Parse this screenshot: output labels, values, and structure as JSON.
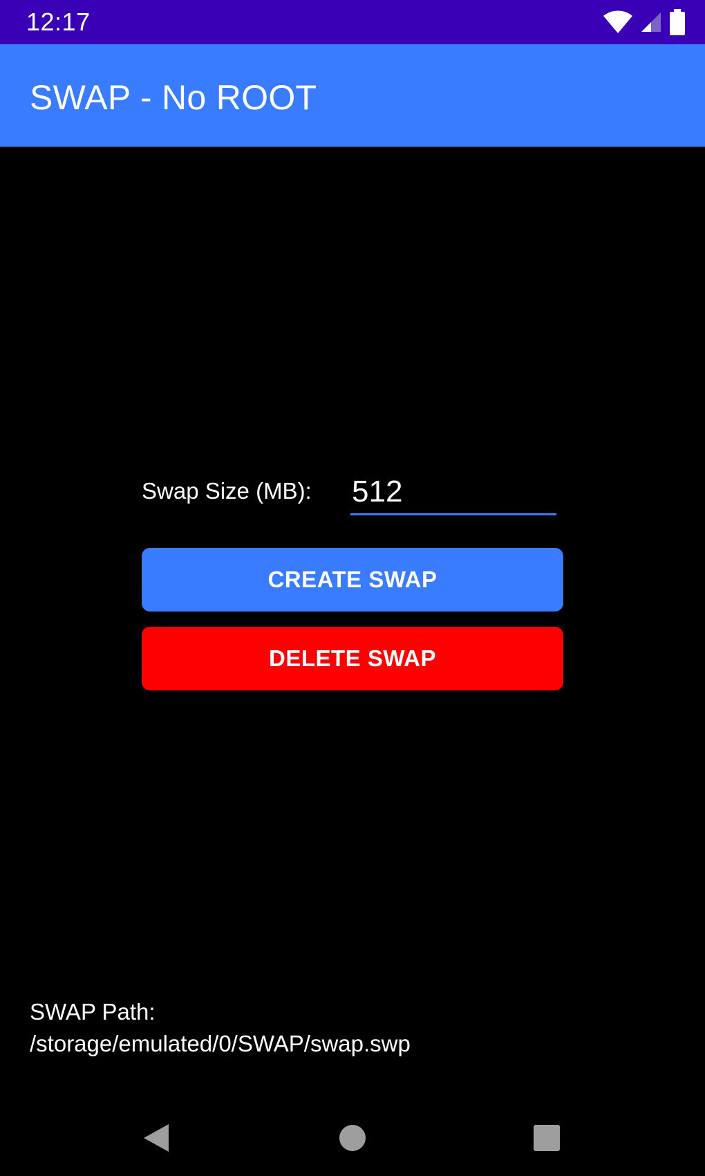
{
  "status_bar": {
    "time": "12:17",
    "icons": [
      "wifi-icon",
      "cell-signal-icon",
      "battery-icon"
    ]
  },
  "app_bar": {
    "title": "SWAP - No ROOT"
  },
  "swap_size": {
    "label": "Swap Size (MB):",
    "value": "512"
  },
  "buttons": {
    "create_label": "CREATE SWAP",
    "delete_label": "DELETE SWAP"
  },
  "swap_path": {
    "label": "SWAP Path:",
    "value": "/storage/emulated/0/SWAP/swap.swp"
  },
  "nav_bar": {
    "icons": [
      "back-icon",
      "home-icon",
      "recents-icon"
    ]
  },
  "colors": {
    "status_bar": "#3a00b6",
    "accent": "#3a7cff",
    "danger": "#ff0000",
    "background": "#000000",
    "text": "#ffffff",
    "nav_icon": "#9e9e9e"
  }
}
